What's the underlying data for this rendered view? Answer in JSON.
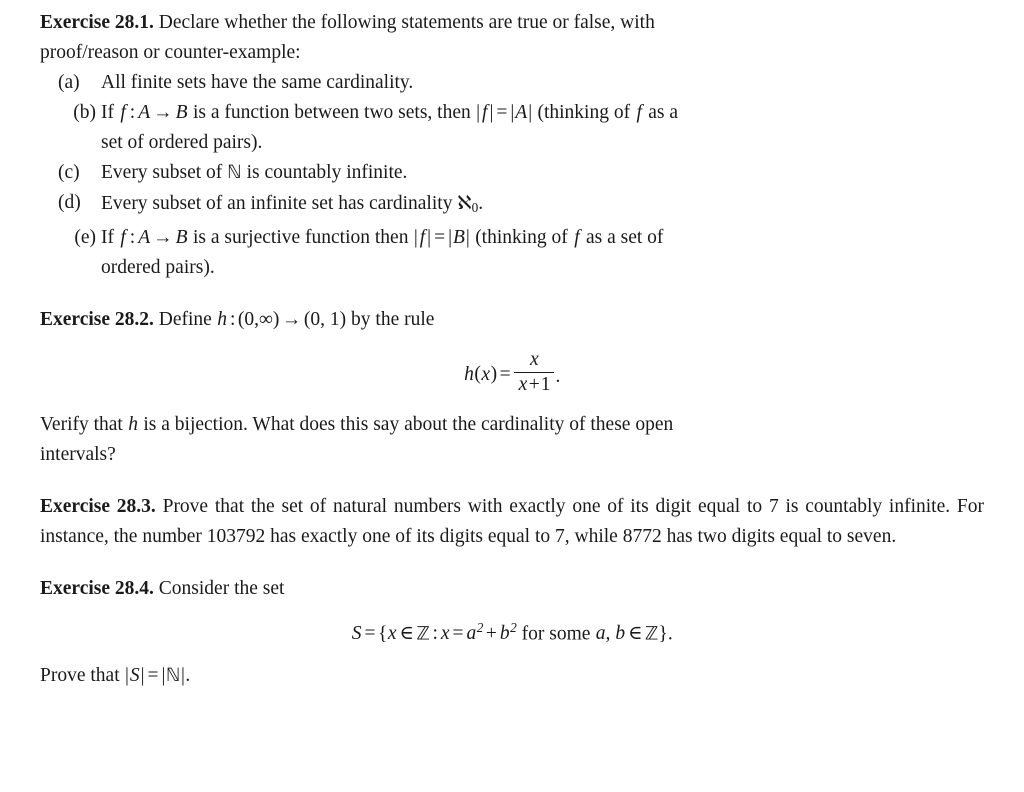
{
  "document": {
    "type": "mathematics-exercise-page",
    "blocks": [
      {
        "id": "ex_28_1",
        "heading": "Exercise 28.1.",
        "intro": "Declare whether the following statements are true or false, with proof/reason or counter-example:",
        "items": [
          {
            "marker": "(a)",
            "text": "All finite sets have the same cardinality."
          },
          {
            "marker": "(b)",
            "text": "If f : A → B is a function between two sets, then |f| = |A| (thinking of f as a set of ordered pairs)."
          },
          {
            "marker": "(c)",
            "text": "Every subset of N is countably infinite."
          },
          {
            "marker": "(d)",
            "text": "Every subset of an infinite set has cardinality ℵ0."
          },
          {
            "marker": "(e)",
            "text": "If f : A → B is a surjective function then |f| = |B| (thinking of f as a set of ordered pairs)."
          }
        ]
      },
      {
        "id": "ex_28_2",
        "heading": "Exercise 28.2.",
        "intro": "Define h : (0, ∞) → (0, 1) by the rule",
        "display": "h(x) = x / (x + 1).",
        "outro": "Verify that h is a bijection. What does this say about the cardinality of these open intervals?"
      },
      {
        "id": "ex_28_3",
        "heading": "Exercise 28.3.",
        "intro": "Prove that the set of natural numbers with exactly one of its digit equal to 7 is countably infinite. For instance, the number 103792 has exactly one of its digits equal to 7, while 8772 has two digits equal to seven.",
        "example_numbers": [
          "7",
          "103792",
          "8772"
        ]
      },
      {
        "id": "ex_28_4",
        "heading": "Exercise 28.4.",
        "intro": "Consider the set",
        "display": "S = {x ∈ Z : x = a² + b² for some a, b ∈ Z}.",
        "outro": "Prove that |S| = |N|."
      }
    ],
    "fragments": {
      "ex1_heading": "Exercise 28.1.",
      "ex1_intro_1": "Declare",
      "ex1_intro_2": "whether",
      "ex1_intro_3": "the",
      "ex1_intro_4": "following",
      "ex1_intro_5": "statements",
      "ex1_intro_6": "are",
      "ex1_intro_7": "true",
      "ex1_intro_8": "or",
      "ex1_intro_9": "false,",
      "ex1_intro_10": "with",
      "ex1_intro_11": "proof/reason or counter-example:",
      "a_marker": "(a)",
      "a_text": "All finite sets have the same cardinality.",
      "b_marker": "(b)",
      "b_t1": "If",
      "b_f1": "f",
      "b_colon": ":",
      "b_A": "A",
      "b_arrow": "→",
      "b_B": "B",
      "b_t2": "is a function between two sets, then",
      "b_abs_f": "f",
      "b_eq": "=",
      "b_abs_A": "A",
      "b_t3": "(thinking of",
      "b_f2": "f",
      "b_t4": "as a",
      "b_line2": "set of ordered pairs).",
      "c_marker": "(c)",
      "c_t1": "Every subset of",
      "c_N": "N",
      "c_t2": "is countably infinite.",
      "d_marker": "(d)",
      "d_t1": "Every subset of an infinite set has cardinality",
      "d_aleph": "ℵ",
      "d_sub": "0",
      "d_period": ".",
      "e_marker": "(e)",
      "e_t1": "If",
      "e_f1": "f",
      "e_colon": ":",
      "e_A": "A",
      "e_arrow": "→",
      "e_B": "B",
      "e_t2": "is a surjective function then",
      "e_abs_f": "f",
      "e_eq": "=",
      "e_abs_B": "B",
      "e_t3": "(thinking of",
      "e_f2": "f",
      "e_t4": "as a set of",
      "e_line2": "ordered pairs).",
      "ex2_heading": "Exercise 28.2.",
      "ex2_t1": "Define",
      "ex2_h": "h",
      "ex2_colon": ":",
      "ex2_dom": "(0,",
      "ex2_infty": "∞",
      "ex2_dom_close": ")",
      "ex2_arrow": "→",
      "ex2_codom": "(0, 1)",
      "ex2_t2": "by the rule",
      "ex2_disp_h": "h",
      "ex2_disp_lp": "(",
      "ex2_disp_x1": "x",
      "ex2_disp_rp": ")",
      "ex2_disp_eq": "=",
      "ex2_disp_num": "x",
      "ex2_disp_den_x": "x",
      "ex2_disp_den_plus": "+",
      "ex2_disp_den_1": "1",
      "ex2_disp_period": ".",
      "ex2_o1": "Verify",
      "ex2_o2": "that",
      "ex2_oh": "h",
      "ex2_o3": "is",
      "ex2_o4": "a",
      "ex2_o5": "bijection.",
      "ex2_o6": "What",
      "ex2_o7": "does",
      "ex2_o8": "this",
      "ex2_o9": "say",
      "ex2_o10": "about",
      "ex2_o11": "the",
      "ex2_o12": "cardinality",
      "ex2_o13": "of",
      "ex2_o14": "these",
      "ex2_o15": "open",
      "ex2_o16": "intervals?",
      "ex3_heading": "Exercise 28.3.",
      "ex3_text": "Prove that the set of natural numbers with exactly one of its digit equal to 7 is countably infinite. For instance, the number 103792 has exactly one of its digits equal to 7, while 8772 has two digits equal to seven.",
      "ex4_heading": "Exercise 28.4.",
      "ex4_intro": "Consider the set",
      "ex4_S": "S",
      "ex4_eq1": "=",
      "ex4_lbrace": "{",
      "ex4_x1": "x",
      "ex4_in1": "∈",
      "ex4_Z1": "Z",
      "ex4_colon": ":",
      "ex4_x2": "x",
      "ex4_eq2": "=",
      "ex4_a": "a",
      "ex4_a_exp": "2",
      "ex4_plus": "+",
      "ex4_b": "b",
      "ex4_b_exp": "2",
      "ex4_forsome": "for some",
      "ex4_a2": "a,",
      "ex4_b2": "b",
      "ex4_in2": "∈",
      "ex4_Z2": "Z",
      "ex4_rbrace": "}",
      "ex4_period": ".",
      "ex4_o1": "Prove that",
      "ex4_o_S": "S",
      "ex4_o_eq": "=",
      "ex4_o_N": "N",
      "ex4_o_period": "."
    }
  }
}
